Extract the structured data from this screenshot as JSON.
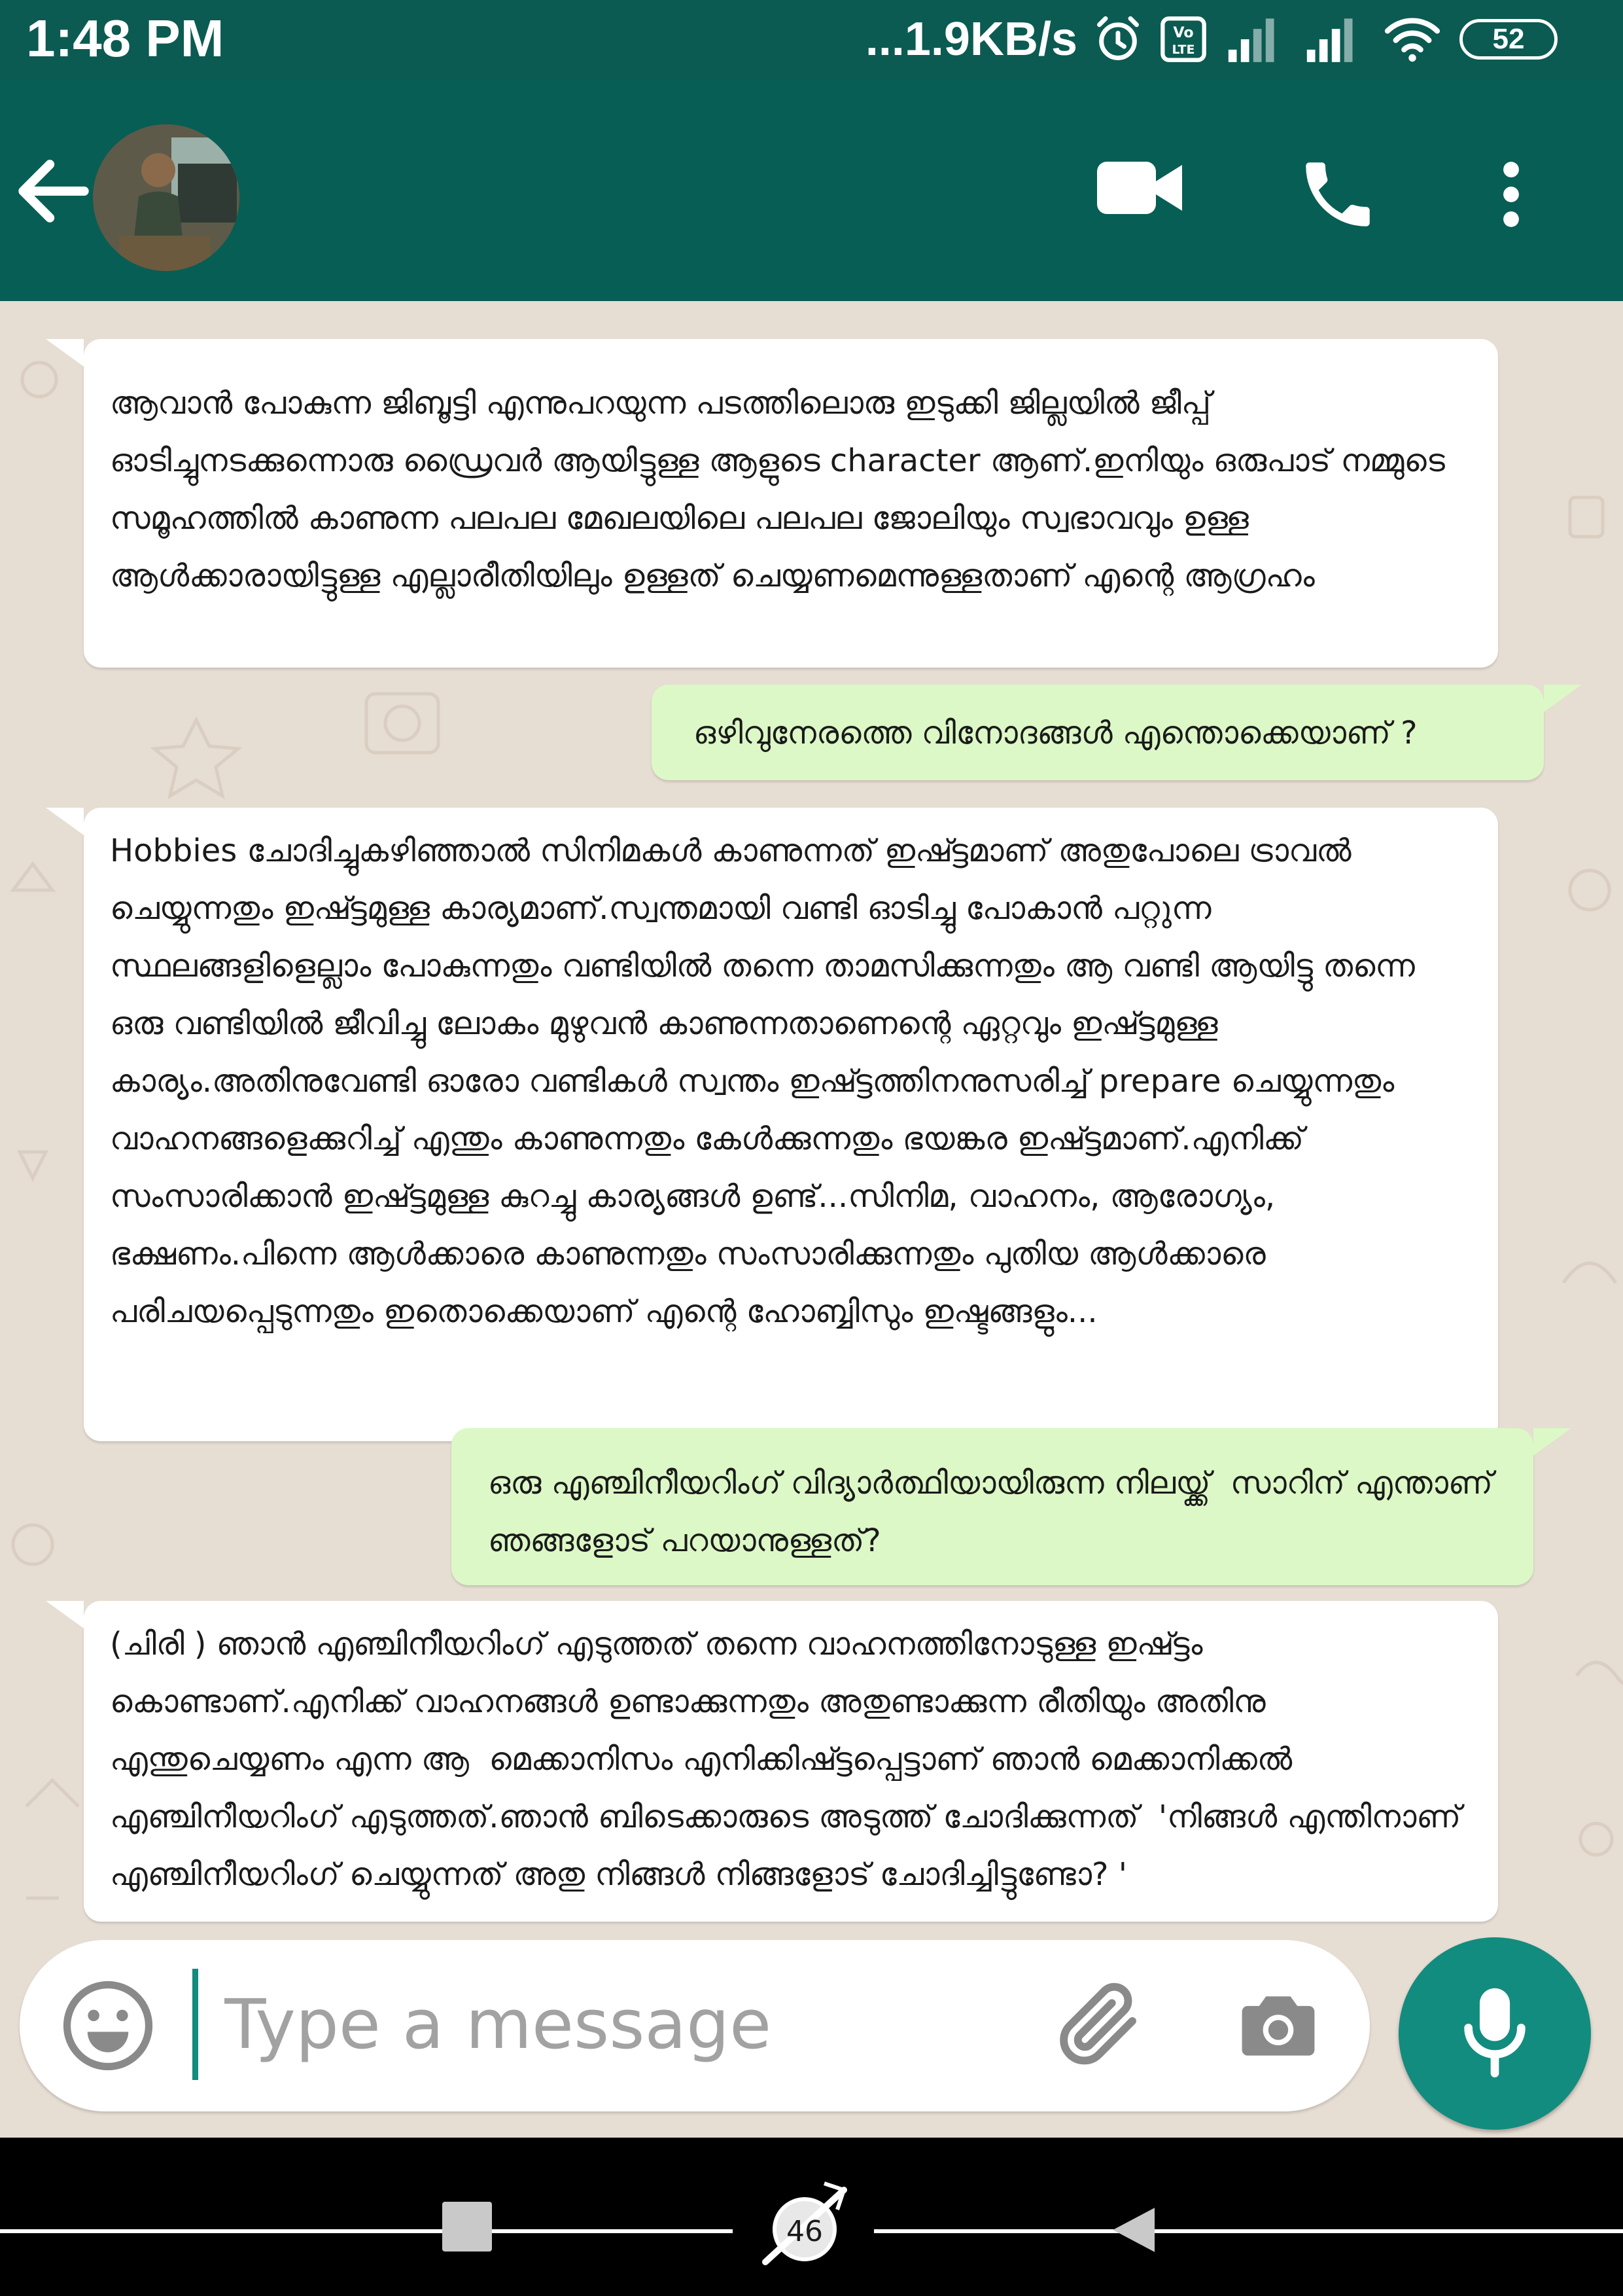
{
  "status_bar": {
    "time": "1:48 PM",
    "network_speed": "...1.9KB/s",
    "battery": "52",
    "icons": [
      "alarm-icon",
      "volte-icon",
      "signal-icon",
      "signal-icon",
      "wifi-icon",
      "battery-icon"
    ]
  },
  "app_bar": {
    "icons": [
      "back-arrow-icon",
      "avatar",
      "video-call-icon",
      "phone-icon",
      "more-vertical-icon"
    ],
    "colors": {
      "background": "#075e54",
      "status_bar": "#0b5b52"
    }
  },
  "messages": [
    {
      "direction": "incoming",
      "text": "ആവാൻ പോകുന്ന ജിബൂട്ടി എന്നുപറയുന്ന പടത്തിലൊരു ഇടുക്കി ജില്ലയിൽ ജീപ്പ് ഓടിച്ചുനടക്കുന്നൊരു ഡ്രൈവർ ആയിട്ടുള്ള ആളുടെ character ആണ്.ഇനിയും ഒരുപാട് നമ്മുടെ സമൂഹത്തിൽ കാണുന്ന പലപല മേഖലയിലെ പലപല ജോലിയും സ്വഭാവവും ഉള്ള ആൾക്കാരായിട്ടുള്ള എല്ലാരീതിയിലും ഉള്ളത് ചെയ്യണമെന്നുള്ളതാണ് എന്റെ ആഗ്രഹം"
    },
    {
      "direction": "outgoing",
      "text": "ഒഴിവുനേരത്തെ വിനോദങ്ങൾ എന്തൊക്കെയാണ് ?"
    },
    {
      "direction": "incoming",
      "text": "Hobbies ചോദിച്ചുകഴിഞ്ഞാൽ സിനിമകൾ കാണുന്നത് ഇഷ്ട്ടമാണ് അതുപോലെ ട്രാവൽ ചെയ്യുന്നതും ഇഷ്ട്ടമുള്ള കാര്യമാണ്.സ്വന്തമായി വണ്ടി ഓടിച്ചു പോകാൻ പറ്റുന്ന സ്ഥലങ്ങളിളെല്ലാം പോകുന്നതും വണ്ടിയിൽ തന്നെ താമസിക്കുന്നതും ആ വണ്ടി ആയിട്ടു തന്നെ ഒരു വണ്ടിയിൽ ജീവിച്ചു ലോകം മുഴുവൻ കാണുന്നതാണെന്റെ ഏറ്റവും ഇഷ്ട്ടമുള്ള കാര്യം.അതിനുവേണ്ടി ഓരോ വണ്ടികൾ സ്വന്തം ഇഷ്ട്ടത്തിനനുസരിച്ച് prepare ചെയ്യുന്നതും വാഹനങ്ങളെക്കുറിച്ച് എന്തും കാണുന്നതും കേൾക്കുന്നതും ഭയങ്കര ഇഷ്ട്ടമാണ്.എനിക്ക് സംസാരിക്കാൻ ഇഷ്ട്ടമുള്ള കുറച്ചു കാര്യങ്ങൾ ഉണ്ട്...സിനിമ, വാഹനം, ആരോഗ്യം, ഭക്ഷണം.പിന്നെ ആൾക്കാരെ കാണുന്നതും സംസാരിക്കുന്നതും പുതിയ ആൾക്കാരെ പരിചയപ്പെടുന്നതും ഇതൊക്കെയാണ് എന്റെ ഹോബ്ബിസും ഇഷ്ടങ്ങളും..."
    },
    {
      "direction": "outgoing",
      "text": "ഒരു എഞ്ചിനീയറിംഗ് വിദ്യാർത്ഥിയായിരുന്ന നിലയ്ക്ക്  സാറിന് എന്താണ് ഞങ്ങളോട് പറയാനുള്ളത്?"
    },
    {
      "direction": "incoming",
      "text": "(ചിരി ) ഞാൻ എഞ്ചിനീയറിംഗ് എടുത്തത് തന്നെ വാഹനത്തിനോടുള്ള ഇഷ്ട്ടം കൊണ്ടാണ്.എനിക്ക് വാഹനങ്ങൾ ഉണ്ടാക്കുന്നതും അതുണ്ടാക്കുന്ന രീതിയും അതിനു എന്തുചെയ്യണം എന്ന ആ  മെക്കാനിസം എനിക്കിഷ്ട്ടപ്പെട്ടാണ് ഞാൻ മെക്കാനിക്കൽ എഞ്ചിനീയറിംഗ് എടുത്തത്.ഞാൻ ബിടെക്കാരുടെ അടുത്ത് ചോദിക്കുന്നത്  'നിങ്ങൾ എന്തിനാണ് എഞ്ചിനീയറിംഗ് ചെയ്യുന്നത് അതു നിങ്ങൾ നിങ്ങളോട് ചോദിച്ചിട്ടുണ്ടോ? '"
    }
  ],
  "input_bar": {
    "placeholder": "Type a message",
    "icons": [
      "emoji-icon",
      "paperclip-icon",
      "camera-icon",
      "microphone-icon"
    ],
    "accent_color": "#128c7e"
  },
  "nav_bar": {
    "page_number": "46",
    "icons": [
      "recents-icon",
      "home-icon",
      "back-triangle-icon"
    ]
  },
  "colors": {
    "incoming_bubble": "#ffffff",
    "outgoing_bubble": "#dcf8c6",
    "chat_background": "#e6ddd3"
  }
}
